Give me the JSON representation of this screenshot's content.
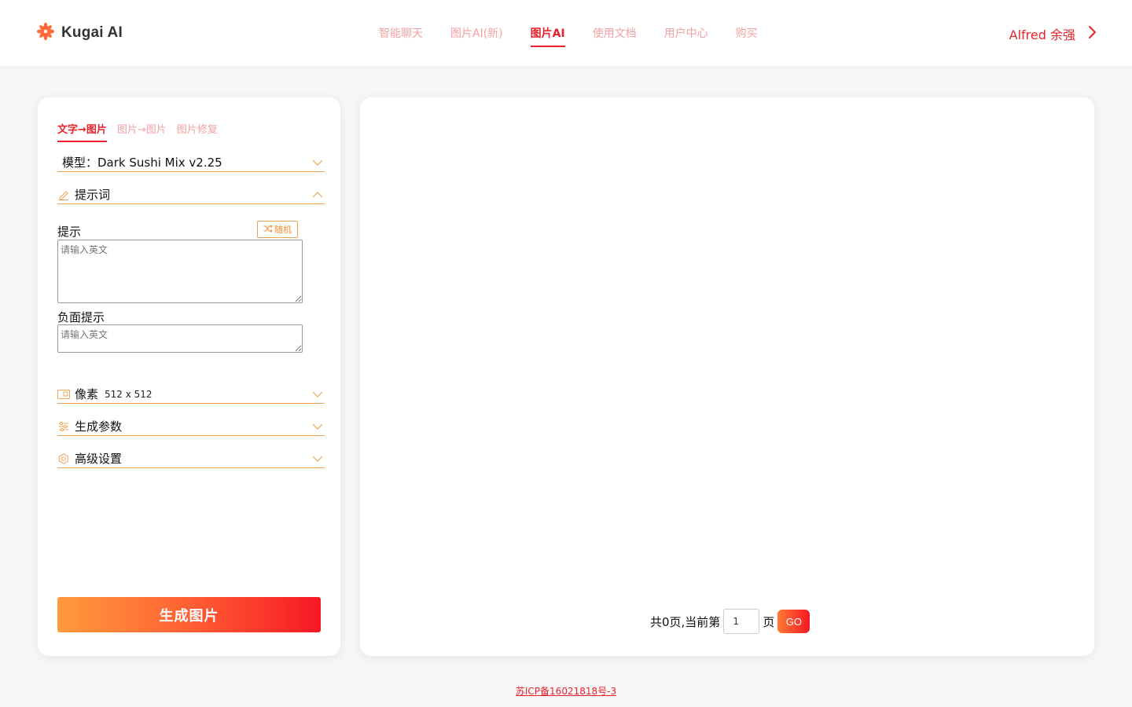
{
  "header": {
    "logo_text": "Kugai AI",
    "nav": [
      "智能聊天",
      "图片AI(新)",
      "图片AI",
      "使用文档",
      "用户中心",
      "购买"
    ],
    "active_nav": "图片AI",
    "user_name": "Alfred 余强"
  },
  "left_panel": {
    "tabs": [
      "文字→图片",
      "图片→图片",
      "图片修复"
    ],
    "active_tab": "文字→图片",
    "model_label": "模型：Dark Sushi Mix v2.25",
    "prompt_section_label": "提示词",
    "prompt_label": "提示",
    "random_button_label": "随机",
    "prompt_placeholder": "请输入英文",
    "negative_prompt_label": "负面提示",
    "negative_prompt_placeholder": "请输入英文",
    "pixel_label": "像素",
    "pixel_value": "512 x 512",
    "gen_params_label": "生成参数",
    "advanced_label": "高级设置",
    "generate_button_label": "生成图片"
  },
  "right_panel": {
    "pager_prefix": "共0页,当前第",
    "page_value": "1",
    "pager_suffix": "页",
    "go_label": "GO"
  },
  "footer": {
    "icp": "苏ICP备16021818号-3"
  },
  "colors": {
    "brand_red": "#e8222a",
    "accent_orange": "#f0a453",
    "nav_inactive": "#f2a1a3"
  }
}
